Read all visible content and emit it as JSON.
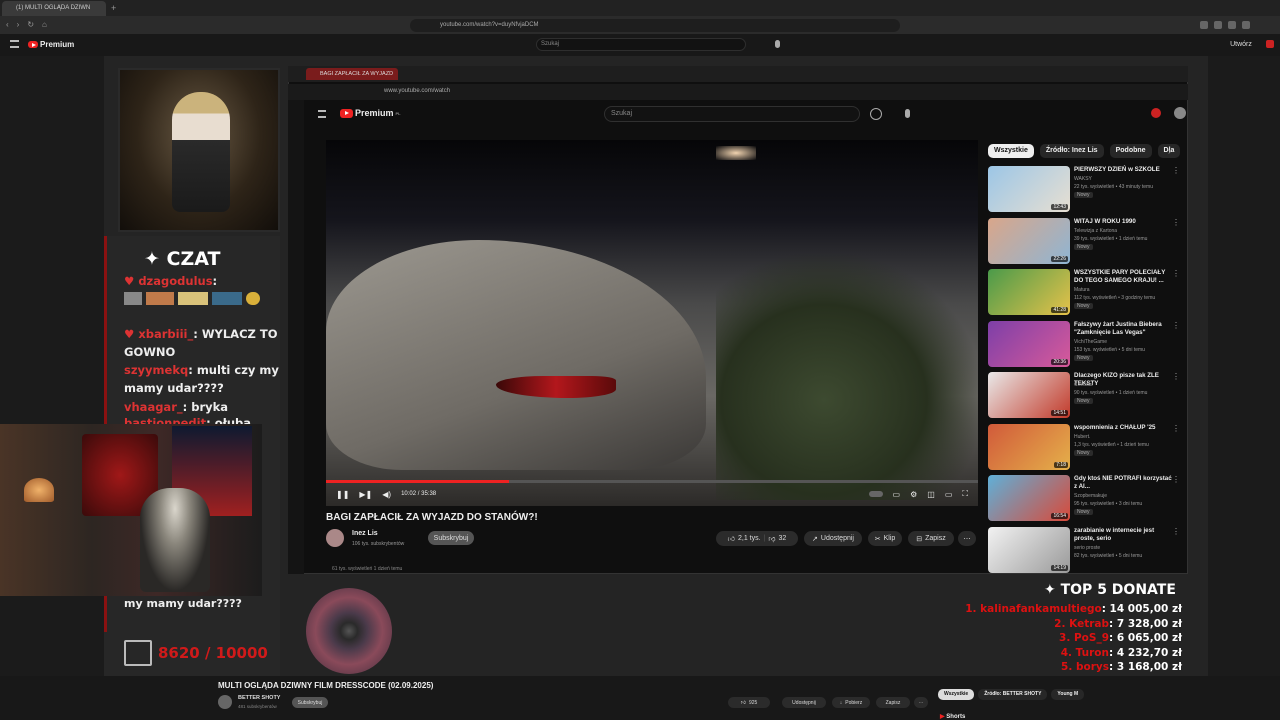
{
  "browser": {
    "tab_title": "(1) MULTI OGLĄDA DZIWN",
    "url": "youtube.com/watch?v=duyNfvjaDCM",
    "search_placeholder": "Szukaj"
  },
  "outer": {
    "logo_text": "Premium",
    "create_label": "Utwórz"
  },
  "stream": {
    "chat_title": "CZAT",
    "chat": [
      {
        "user": "dzagodulus",
        "sep": ":",
        "text": ""
      },
      {
        "user": "xbarbiii_",
        "sep": ":",
        "text": "WYLACZ TO GOWNO"
      },
      {
        "user": "szyymekq",
        "sep": ":",
        "text": "multi czy my mamy udar????"
      },
      {
        "user": "vhaagar_",
        "sep": ":",
        "text": "bryka"
      },
      {
        "user": "bastionpedit",
        "sep": ":",
        "text": "ołuba"
      }
    ],
    "chat_repeat": "my mamy udar????",
    "goal": "8620 / 10000"
  },
  "inner": {
    "tab_title": "BAGI ZAPŁACIŁ ZA WYJAZD",
    "url": "www.youtube.com/watch",
    "logo_text": "Premium",
    "logo_sup": "PL",
    "search_placeholder": "Szukaj",
    "video": {
      "time": "10:02 / 35:38",
      "progress_fraction": 0.28,
      "title": "BAGI ZAPŁACIŁ ZA WYJAZD DO STANÓW?!",
      "channel": "Inez Lis",
      "subs": "106 tys. subskrybentów",
      "subscribe": "Subskrybuj",
      "likes": "2,1 tys.",
      "dislikes": "32",
      "share": "Udostępnij",
      "clip": "Klip",
      "save": "Zapisz",
      "views": "61 tys. wyświetleń  1 dzień temu"
    },
    "chips": [
      "Wszystkie",
      "Źródło: Inez Lis",
      "Podobne",
      "Dla"
    ],
    "recs": [
      {
        "title": "PIERWSZY DZIEŃ w SZKOLE",
        "channel": "WAKSY",
        "meta": "22 tys. wyświetleń • 43 minuty temu",
        "badge": "Nowy",
        "dur": "12:43",
        "c1": "#9cc6e6",
        "c2": "#e7dfd2"
      },
      {
        "title": "WITAJ W ROKU 1990",
        "channel": "Telewizja z Kartona",
        "meta": "39 tys. wyświetleń • 1 dzień temu",
        "badge": "Nowy",
        "dur": "22:26",
        "c1": "#d9a68a",
        "c2": "#8fb5d3"
      },
      {
        "title": "WSZYSTKIE PARY POLECIAŁY DO TEGO SAMEGO KRAJU! ...",
        "channel": "Matura",
        "meta": "112 tys. wyświetleń • 3 godziny temu",
        "badge": "Nowy",
        "dur": "41:28",
        "c1": "#4a9a4a",
        "c2": "#e6c24a"
      },
      {
        "title": "Fałszywy żart Justina Biebera \"Zamknięcie Las Vegas\"",
        "channel": "VichiTheGame",
        "meta": "153 tys. wyświetleń • 5 dni temu",
        "badge": "Nowy",
        "dur": "20:36",
        "c1": "#7d3fa8",
        "c2": "#d85a9a"
      },
      {
        "title": "Dlaczego KIZO pisze tak ZLE TEKSTY",
        "channel": "Cheddar",
        "meta": "90 tys. wyświetleń • 1 dzień temu",
        "badge": "Nowy",
        "dur": "14:51",
        "c1": "#e9e9e9",
        "c2": "#c23a2a"
      },
      {
        "title": "wspomnienia z CHAŁUP '25",
        "channel": "Hubert.",
        "meta": "1,3 tys. wyświetleń • 1 dzień temu",
        "badge": "Nowy",
        "dur": "7:18",
        "c1": "#d15a3a",
        "c2": "#e5b04a"
      },
      {
        "title": "Gdy ktoś NIE POTRAFI korzystać z AI...",
        "channel": "Szopbemakuje",
        "meta": "95 tys. wyświetleń • 3 dni temu",
        "badge": "Nowy",
        "dur": "16:54",
        "c1": "#5fb0d8",
        "c2": "#d84a3a"
      },
      {
        "title": "zarabianie w internecie jest proste, serio",
        "channel": "serio proste",
        "meta": "82 tys. wyświetleń • 5 dni temu",
        "badge": "",
        "dur": "14:19",
        "c1": "#f2f2f2",
        "c2": "#9a9a9a"
      }
    ]
  },
  "donate": {
    "title": "TOP 5 DONATE",
    "rows": [
      {
        "rank": "1.",
        "name": "kalinafankamultiego",
        "amount": ": 14 005,00 zł"
      },
      {
        "rank": "2.",
        "name": "Ketrab",
        "amount": ": 7 328,00 zł"
      },
      {
        "rank": "3.",
        "name": "PoS_9",
        "amount": ": 6 065,00 zł"
      },
      {
        "rank": "4.",
        "name": "Turon",
        "amount": ": 4 232,70 zł"
      },
      {
        "rank": "5.",
        "name": "borys",
        "amount": ": 3 168,00 zł"
      }
    ]
  },
  "bottom": {
    "title": "MULTI OGLĄDA DZIWNY FILM DRESSCODE (02.09.2025)",
    "channel": "BETTER SHOTY",
    "subs": "481 subskrybentów",
    "subscribe": "Subskrybuj",
    "likes": "925",
    "share": "Udostępnij",
    "download": "Pobierz",
    "save": "Zapisz",
    "chips": [
      "Wszystkie",
      "Źródło: BETTER SHOTY",
      "Young M"
    ],
    "shorts": "Shorts"
  }
}
